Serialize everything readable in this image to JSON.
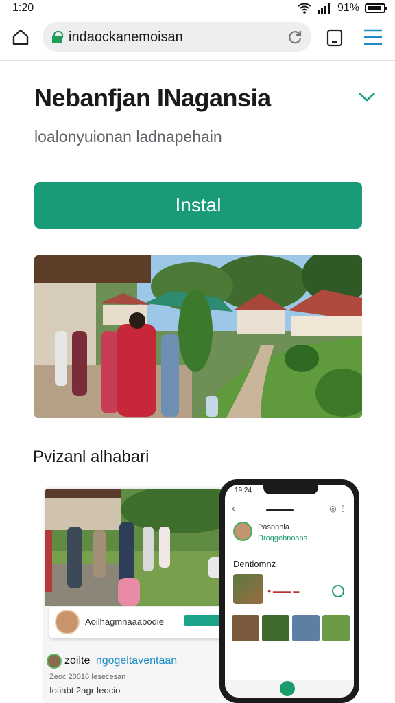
{
  "status_bar": {
    "time": "1:20",
    "battery": "91%"
  },
  "browser": {
    "url": "indaockanemoisan"
  },
  "app": {
    "title": "Nebanfjan INagansia",
    "subtitle": "loalonyuionan ladnapehain",
    "install_label": "Instal"
  },
  "section": {
    "title": "Pvizanl alhabari"
  },
  "screenshot1": {
    "card_label": "Aoilhagmnaaabodie",
    "footer_title": "zoilte",
    "footer_link": "ngogeltaventaan",
    "meta1": "Zeoc 20016 Iesecesan",
    "meta2": "Iotiabt  2agr  Ieocio"
  },
  "phone_screen": {
    "time": "19:24",
    "name": "Pasnnhia",
    "sub": "Droqgebnoans",
    "section": "Dentiomnz"
  },
  "colors": {
    "accent": "#199a78",
    "link": "#1a8cc7"
  }
}
